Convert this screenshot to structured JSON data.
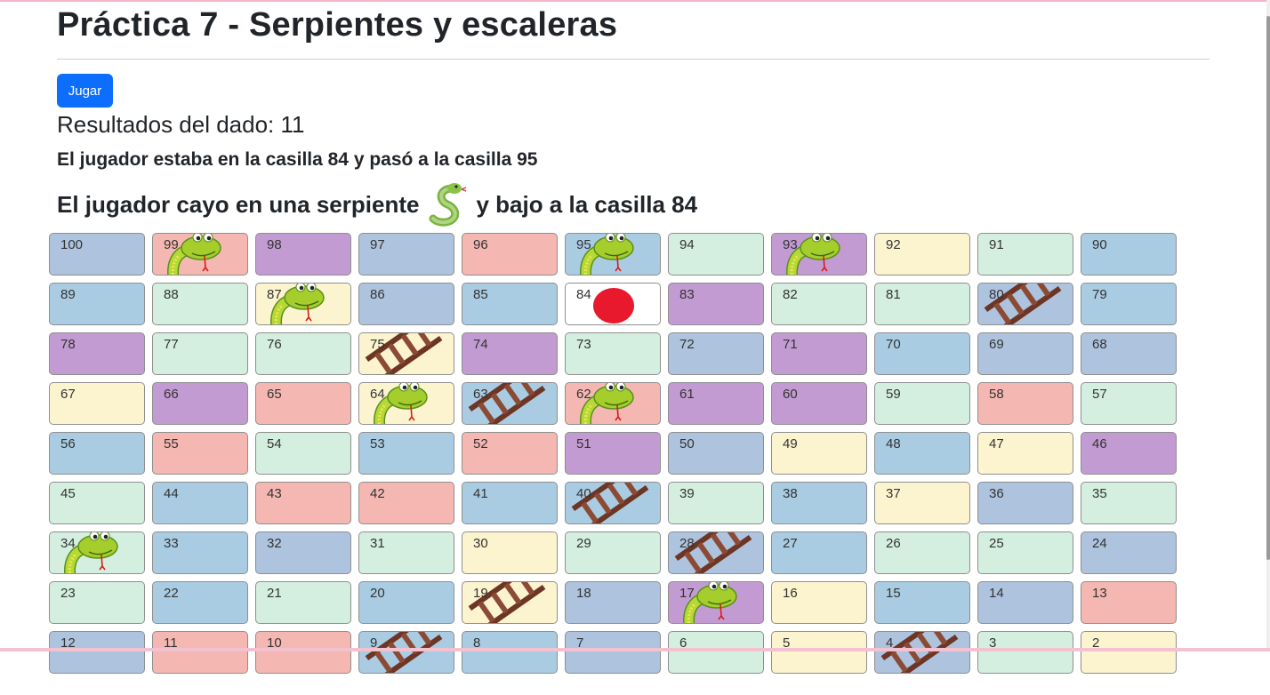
{
  "title": "Práctica 7 - Serpientes y escaleras",
  "play_button": "Jugar",
  "dice_result": "Resultados del dado: 11",
  "move_text": "El jugador estaba en la casilla 84 y pasó a la casilla 95",
  "snake_text_before": "El jugador cayo en una serpiente",
  "snake_text_after": "y bajo a la casilla 84",
  "colors": {
    "purple": "#c39bd3",
    "blue": "#a9cce3",
    "steel": "#aec3de",
    "pink": "#f5b7b1",
    "green": "#d4efdf",
    "yellow": "#fcf3cf",
    "white": "#ffffff",
    "token": "#e8192c",
    "button": "#0d6efd"
  },
  "board": {
    "rows": [
      [
        {
          "n": "100",
          "color": "steel"
        },
        {
          "n": "99",
          "color": "pink",
          "item": "snake"
        },
        {
          "n": "98",
          "color": "purple"
        },
        {
          "n": "97",
          "color": "steel"
        },
        {
          "n": "96",
          "color": "pink"
        },
        {
          "n": "95",
          "color": "blue",
          "item": "snake"
        },
        {
          "n": "94",
          "color": "green"
        },
        {
          "n": "93",
          "color": "purple",
          "item": "snake"
        },
        {
          "n": "92",
          "color": "yellow"
        },
        {
          "n": "91",
          "color": "green"
        },
        {
          "n": "90",
          "color": "blue"
        }
      ],
      [
        {
          "n": "89",
          "color": "blue"
        },
        {
          "n": "88",
          "color": "green"
        },
        {
          "n": "87",
          "color": "yellow",
          "item": "snake"
        },
        {
          "n": "86",
          "color": "steel"
        },
        {
          "n": "85",
          "color": "blue"
        },
        {
          "n": "84",
          "color": "white",
          "item": "token"
        },
        {
          "n": "83",
          "color": "purple"
        },
        {
          "n": "82",
          "color": "green"
        },
        {
          "n": "81",
          "color": "green"
        },
        {
          "n": "80",
          "color": "steel",
          "item": "ladder"
        },
        {
          "n": "79",
          "color": "blue"
        }
      ],
      [
        {
          "n": "78",
          "color": "purple"
        },
        {
          "n": "77",
          "color": "green"
        },
        {
          "n": "76",
          "color": "green"
        },
        {
          "n": "75",
          "color": "yellow",
          "item": "ladder"
        },
        {
          "n": "74",
          "color": "purple"
        },
        {
          "n": "73",
          "color": "green"
        },
        {
          "n": "72",
          "color": "steel"
        },
        {
          "n": "71",
          "color": "purple"
        },
        {
          "n": "70",
          "color": "blue"
        },
        {
          "n": "69",
          "color": "steel"
        },
        {
          "n": "68",
          "color": "steel"
        }
      ],
      [
        {
          "n": "67",
          "color": "yellow"
        },
        {
          "n": "66",
          "color": "purple"
        },
        {
          "n": "65",
          "color": "pink"
        },
        {
          "n": "64",
          "color": "yellow",
          "item": "snake"
        },
        {
          "n": "63",
          "color": "blue",
          "item": "ladder"
        },
        {
          "n": "62",
          "color": "pink",
          "item": "snake"
        },
        {
          "n": "61",
          "color": "purple"
        },
        {
          "n": "60",
          "color": "purple"
        },
        {
          "n": "59",
          "color": "green"
        },
        {
          "n": "58",
          "color": "pink"
        },
        {
          "n": "57",
          "color": "green"
        }
      ],
      [
        {
          "n": "56",
          "color": "blue"
        },
        {
          "n": "55",
          "color": "pink"
        },
        {
          "n": "54",
          "color": "green"
        },
        {
          "n": "53",
          "color": "blue"
        },
        {
          "n": "52",
          "color": "pink"
        },
        {
          "n": "51",
          "color": "purple"
        },
        {
          "n": "50",
          "color": "steel"
        },
        {
          "n": "49",
          "color": "yellow"
        },
        {
          "n": "48",
          "color": "blue"
        },
        {
          "n": "47",
          "color": "yellow"
        },
        {
          "n": "46",
          "color": "purple"
        }
      ],
      [
        {
          "n": "45",
          "color": "green"
        },
        {
          "n": "44",
          "color": "blue"
        },
        {
          "n": "43",
          "color": "pink"
        },
        {
          "n": "42",
          "color": "pink"
        },
        {
          "n": "41",
          "color": "blue"
        },
        {
          "n": "40",
          "color": "blue",
          "item": "ladder"
        },
        {
          "n": "39",
          "color": "green"
        },
        {
          "n": "38",
          "color": "blue"
        },
        {
          "n": "37",
          "color": "yellow"
        },
        {
          "n": "36",
          "color": "steel"
        },
        {
          "n": "35",
          "color": "green"
        }
      ],
      [
        {
          "n": "34",
          "color": "green",
          "item": "snake"
        },
        {
          "n": "33",
          "color": "blue"
        },
        {
          "n": "32",
          "color": "steel"
        },
        {
          "n": "31",
          "color": "green"
        },
        {
          "n": "30",
          "color": "yellow"
        },
        {
          "n": "29",
          "color": "green"
        },
        {
          "n": "28",
          "color": "steel",
          "item": "ladder"
        },
        {
          "n": "27",
          "color": "blue"
        },
        {
          "n": "26",
          "color": "green"
        },
        {
          "n": "25",
          "color": "green"
        },
        {
          "n": "24",
          "color": "steel"
        }
      ],
      [
        {
          "n": "23",
          "color": "green"
        },
        {
          "n": "22",
          "color": "blue"
        },
        {
          "n": "21",
          "color": "green"
        },
        {
          "n": "20",
          "color": "blue"
        },
        {
          "n": "19",
          "color": "yellow",
          "item": "ladder"
        },
        {
          "n": "18",
          "color": "steel"
        },
        {
          "n": "17",
          "color": "purple",
          "item": "snake"
        },
        {
          "n": "16",
          "color": "yellow"
        },
        {
          "n": "15",
          "color": "blue"
        },
        {
          "n": "14",
          "color": "steel"
        },
        {
          "n": "13",
          "color": "pink"
        }
      ],
      [
        {
          "n": "12",
          "color": "steel"
        },
        {
          "n": "11",
          "color": "pink"
        },
        {
          "n": "10",
          "color": "pink"
        },
        {
          "n": "9",
          "color": "blue",
          "item": "ladder"
        },
        {
          "n": "8",
          "color": "blue"
        },
        {
          "n": "7",
          "color": "steel"
        },
        {
          "n": "6",
          "color": "green"
        },
        {
          "n": "5",
          "color": "yellow"
        },
        {
          "n": "4",
          "color": "steel",
          "item": "ladder"
        },
        {
          "n": "3",
          "color": "green"
        },
        {
          "n": "2",
          "color": "yellow"
        }
      ]
    ]
  }
}
